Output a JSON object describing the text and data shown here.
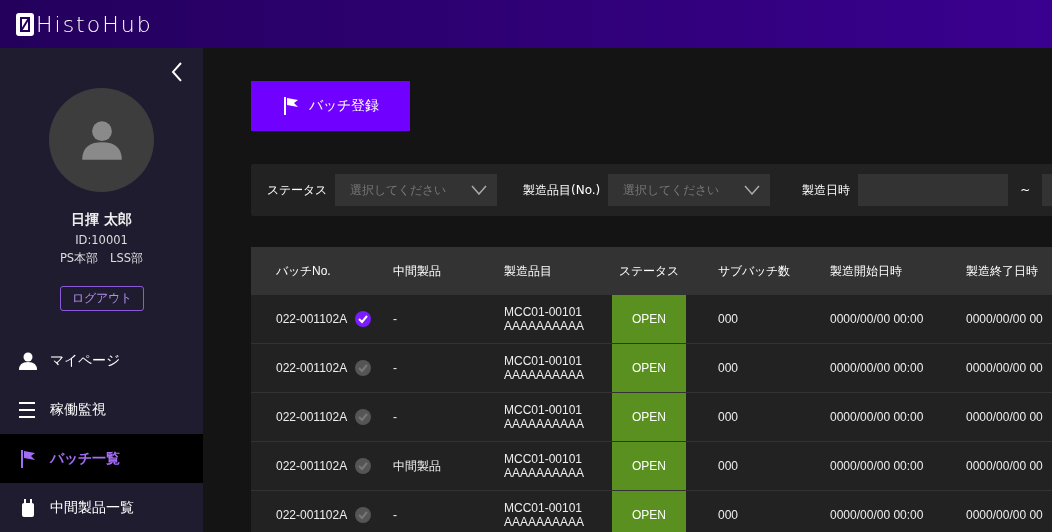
{
  "header": {
    "logo": "HistoHub"
  },
  "sidebar": {
    "user": {
      "name": "日揮 太郎",
      "id": "ID:10001",
      "department": "PS本部　LSS部"
    },
    "logout": "ログアウト",
    "nav": [
      {
        "label": "マイページ",
        "selected": false
      },
      {
        "label": "稼働監視",
        "selected": false
      },
      {
        "label": "バッチ一覧",
        "selected": true
      },
      {
        "label": "中間製品一覧",
        "selected": false
      }
    ]
  },
  "register_button": "バッチ登録",
  "filters": {
    "status": {
      "label": "ステータス",
      "placeholder": "選択してください"
    },
    "product": {
      "label": "製造品目(No.)",
      "placeholder": "選択してください"
    },
    "date": {
      "label": "製造日時",
      "separator": "~"
    }
  },
  "table": {
    "columns": [
      "バッチNo.",
      "中間製品",
      "製造品目",
      "ステータス",
      "サブバッチ数",
      "製造開始日時",
      "製造終了日時"
    ],
    "rows": [
      {
        "batch": "022-001102A",
        "checked": true,
        "intermediate": "-",
        "product": [
          "MCC01-00101",
          "AAAAAAAAAA"
        ],
        "status": "OPEN",
        "sub_batches": "000",
        "start": "0000/00/00 00:00",
        "end": "0000/00/00 00"
      },
      {
        "batch": "022-001102A",
        "checked": false,
        "intermediate": "-",
        "product": [
          "MCC01-00101",
          "AAAAAAAAAA"
        ],
        "status": "OPEN",
        "sub_batches": "000",
        "start": "0000/00/00 00:00",
        "end": "0000/00/00 00"
      },
      {
        "batch": "022-001102A",
        "checked": false,
        "intermediate": "-",
        "product": [
          "MCC01-00101",
          "AAAAAAAAAA"
        ],
        "status": "OPEN",
        "sub_batches": "000",
        "start": "0000/00/00 00:00",
        "end": "0000/00/00 00"
      },
      {
        "batch": "022-001102A",
        "checked": false,
        "intermediate": "中間製品",
        "product": [
          "MCC01-00101",
          "AAAAAAAAAA"
        ],
        "status": "OPEN",
        "sub_batches": "000",
        "start": "0000/00/00 00:00",
        "end": "0000/00/00 00"
      },
      {
        "batch": "022-001102A",
        "checked": false,
        "intermediate": "-",
        "product": [
          "MCC01-00101",
          "AAAAAAAAAA"
        ],
        "status": "OPEN",
        "sub_batches": "000",
        "start": "0000/00/00 00:00",
        "end": "0000/00/00 00"
      }
    ]
  }
}
